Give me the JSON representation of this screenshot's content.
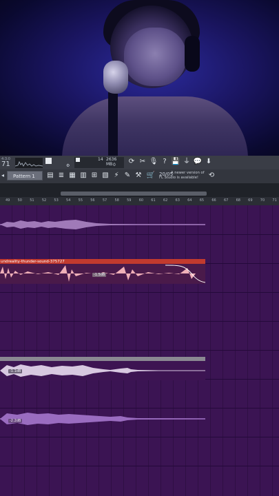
{
  "toolbar": {
    "tempo_small": "4:3:0",
    "tempo_value": "71",
    "cpu_label": "14",
    "memory_label": "2636 MB",
    "voices_label": "0",
    "pattern_label": "Pattern 1",
    "notification_date": "20/05",
    "notification_text_1": "A newer version of",
    "notification_text_2": "FL Studio is available!"
  },
  "ruler": {
    "labels": [
      "49",
      "50",
      "51",
      "52",
      "53",
      "54",
      "55",
      "56",
      "57",
      "58",
      "59",
      "60",
      "61",
      "62",
      "63",
      "64",
      "65",
      "66",
      "67",
      "68",
      "69",
      "70",
      "71"
    ]
  },
  "tracks": [
    {
      "title": "",
      "volume_label": ""
    },
    {
      "title": "undreality-thunder-sound-375727",
      "volume_label": "-1.5dB"
    },
    {
      "title": "",
      "volume_label": "-1.1dB"
    },
    {
      "title": "",
      "volume_label": "-2.2dB"
    }
  ],
  "colors": {
    "playlist_bg": "#3b1453",
    "clip_red": "#c23a2e",
    "clip_pink": "#f0b0b8",
    "clip_light": "#d8c8e0",
    "clip_purple": "#9a6cc0"
  }
}
